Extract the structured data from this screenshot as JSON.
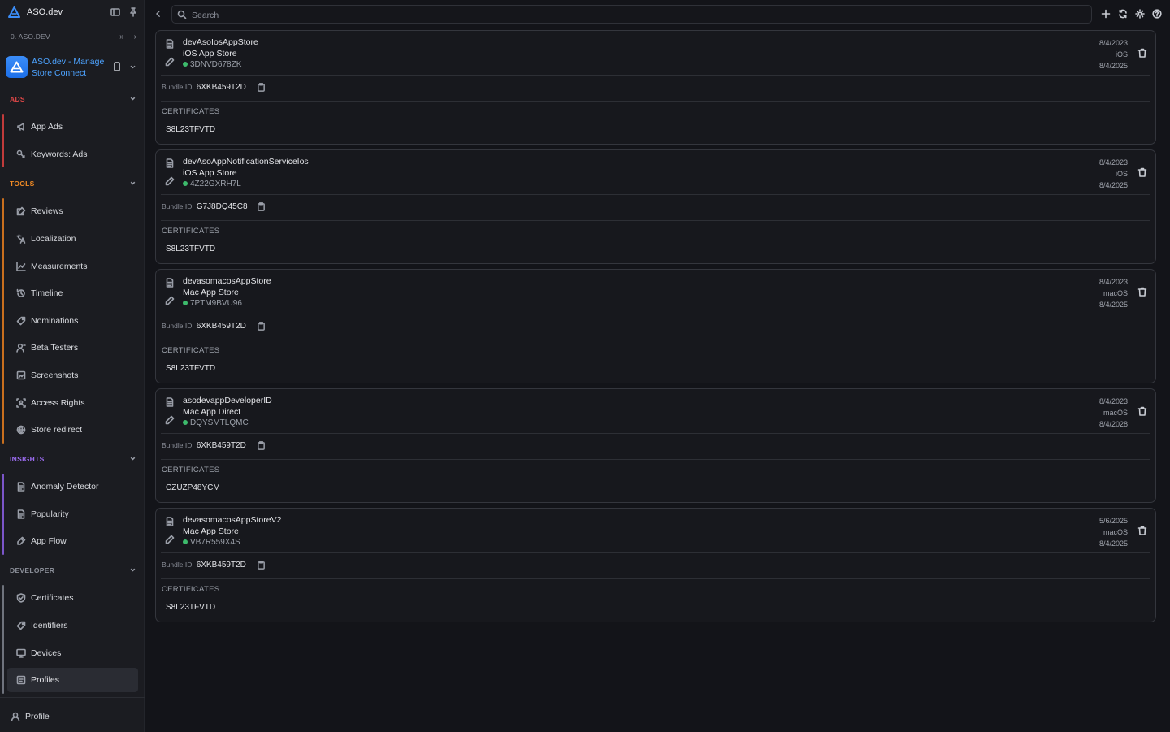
{
  "brand": {
    "name": "ASO.dev"
  },
  "org": {
    "name": "0. ASO.DEV"
  },
  "app": {
    "name": "ASO.dev - Manage Store Connect"
  },
  "sections": {
    "ads": {
      "title": "ADS",
      "color": "#e04848",
      "items": [
        {
          "label": "App Ads",
          "icon": "megaphone-icon"
        },
        {
          "label": "Keywords: Ads",
          "icon": "keywords-icon"
        }
      ]
    },
    "tools": {
      "title": "TOOLS",
      "color": "#f08a24",
      "items": [
        {
          "label": "Reviews",
          "icon": "reviews-icon"
        },
        {
          "label": "Localization",
          "icon": "translate-icon"
        },
        {
          "label": "Measurements",
          "icon": "chart-icon"
        },
        {
          "label": "Timeline",
          "icon": "history-icon"
        },
        {
          "label": "Nominations",
          "icon": "tag-icon"
        },
        {
          "label": "Beta Testers",
          "icon": "user-icon"
        },
        {
          "label": "Screenshots",
          "icon": "image-icon"
        },
        {
          "label": "Access Rights",
          "icon": "access-icon"
        },
        {
          "label": "Store redirect",
          "icon": "globe-icon"
        }
      ]
    },
    "insights": {
      "title": "INSIGHTS",
      "color": "#9b6cf0",
      "items": [
        {
          "label": "Anomaly Detector",
          "icon": "document-icon"
        },
        {
          "label": "Popularity",
          "icon": "document-icon"
        },
        {
          "label": "App Flow",
          "icon": "flow-icon"
        }
      ]
    },
    "developer": {
      "title": "DEVELOPER",
      "color": "#8c909a",
      "items": [
        {
          "label": "Certificates",
          "icon": "shield-icon"
        },
        {
          "label": "Identifiers",
          "icon": "tag-icon"
        },
        {
          "label": "Devices",
          "icon": "monitor-icon"
        },
        {
          "label": "Profiles",
          "icon": "folder-icon"
        }
      ]
    }
  },
  "profile_link": {
    "label": "Profile"
  },
  "search": {
    "placeholder": "Search"
  },
  "bundle_label": "Bundle ID:",
  "certificates_label": "CERTIFICATES",
  "profiles": [
    {
      "name": "devAsoIosAppStore",
      "type": "iOS App Store",
      "id": "3DNVD678ZK",
      "created": "8/4/2023",
      "platform": "iOS",
      "expires": "8/4/2025",
      "bundle_id": "6XKB459T2D",
      "certificate": "S8L23TFVTD"
    },
    {
      "name": "devAsoAppNotificationServiceIos",
      "type": "iOS App Store",
      "id": "4Z22GXRH7L",
      "created": "8/4/2023",
      "platform": "iOS",
      "expires": "8/4/2025",
      "bundle_id": "G7J8DQ45C8",
      "certificate": "S8L23TFVTD"
    },
    {
      "name": "devasomacosAppStore",
      "type": "Mac App Store",
      "id": "7PTM9BVU96",
      "created": "8/4/2023",
      "platform": "macOS",
      "expires": "8/4/2025",
      "bundle_id": "6XKB459T2D",
      "certificate": "S8L23TFVTD"
    },
    {
      "name": "asodevappDeveloperID",
      "type": "Mac App Direct",
      "id": "DQYSMTLQMC",
      "created": "8/4/2023",
      "platform": "macOS",
      "expires": "8/4/2028",
      "bundle_id": "6XKB459T2D",
      "certificate": "CZUZP48YCM"
    },
    {
      "name": "devasomacosAppStoreV2",
      "type": "Mac App Store",
      "id": "VB7R559X4S",
      "created": "5/6/2025",
      "platform": "macOS",
      "expires": "8/4/2025",
      "bundle_id": "6XKB459T2D",
      "certificate": "S8L23TFVTD"
    }
  ]
}
